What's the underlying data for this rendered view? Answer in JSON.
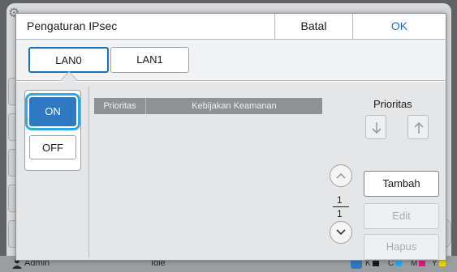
{
  "dialog": {
    "title": "Pengaturan IPsec",
    "cancel_label": "Batal",
    "ok_label": "OK"
  },
  "tabs": [
    {
      "label": "LAN0",
      "selected": true
    },
    {
      "label": "LAN1",
      "selected": false
    }
  ],
  "toggle": {
    "on_label": "ON",
    "off_label": "OFF",
    "selected": "ON"
  },
  "list": {
    "columns": [
      "Prioritas",
      "Kebijakan Keamanan"
    ],
    "rows": []
  },
  "priority": {
    "label": "Prioritas",
    "down_icon": "arrow-down-icon",
    "up_icon": "arrow-up-icon"
  },
  "pagination": {
    "current": "1",
    "total": "1"
  },
  "actions": {
    "add_label": "Tambah",
    "edit_label": "Edit",
    "delete_label": "Hapus"
  },
  "statusbar": {
    "user": "Admin",
    "state": "Idle",
    "inks": [
      {
        "label": "K",
        "color": "#1a1a1a"
      },
      {
        "label": "C",
        "color": "#29a9e8"
      },
      {
        "label": "M",
        "color": "#e0197d"
      },
      {
        "label": "Y",
        "color": "#f2d500"
      }
    ]
  },
  "colors": {
    "accent": "#1a6fc2",
    "on_fill": "#2f78c4",
    "focus_ring": "#29a9e8"
  }
}
